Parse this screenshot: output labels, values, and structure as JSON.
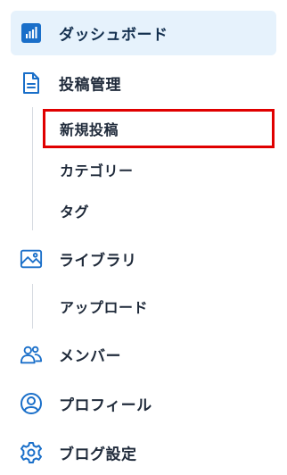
{
  "nav": {
    "dashboard": {
      "label": "ダッシュボード",
      "icon": "bar-chart-icon",
      "active": true
    },
    "posts": {
      "label": "投稿管理",
      "icon": "document-icon"
    },
    "posts_sub": [
      {
        "label": "新規投稿",
        "highlighted": true
      },
      {
        "label": "カテゴリー"
      },
      {
        "label": "タグ"
      }
    ],
    "library": {
      "label": "ライブラリ",
      "icon": "image-icon"
    },
    "library_sub": [
      {
        "label": "アップロード"
      }
    ],
    "members": {
      "label": "メンバー",
      "icon": "users-icon"
    },
    "profile": {
      "label": "プロフィール",
      "icon": "user-circle-icon"
    },
    "blog_settings": {
      "label": "ブログ設定",
      "icon": "gear-icon"
    }
  },
  "colors": {
    "active_bg": "#e6f2fc",
    "accent": "#1a6fc9",
    "icon": "#1a6fc9",
    "text": "#1f2a3a",
    "highlight_border": "#e00000",
    "sub_line": "#d6dbe1"
  }
}
